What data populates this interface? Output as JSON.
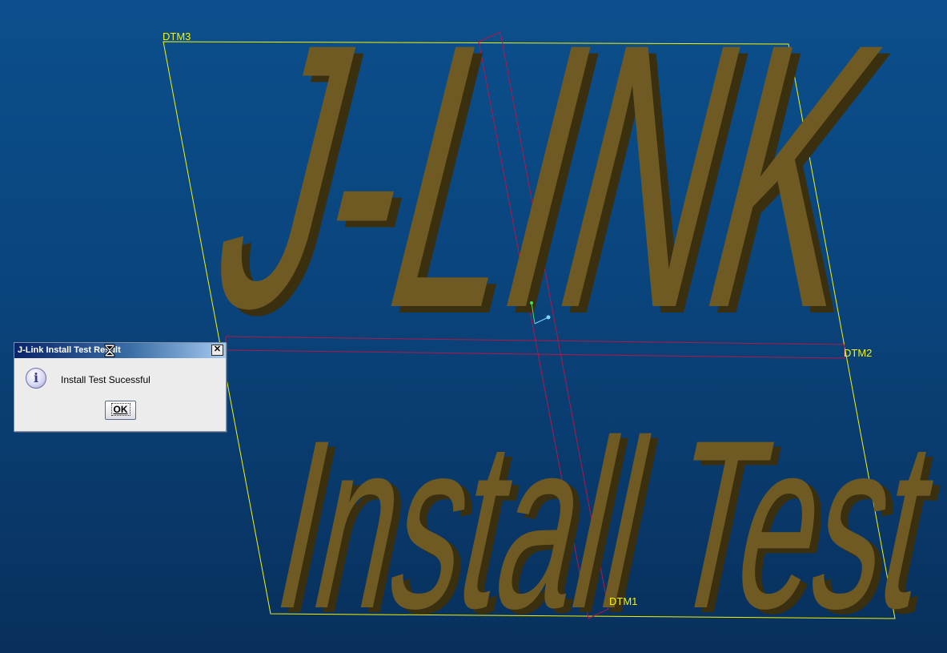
{
  "viewport": {
    "datums": {
      "top_plane": "DTM3",
      "front_plane": "DTM2",
      "right_plane": "DTM1"
    },
    "model_text": {
      "line1": "J-LINK",
      "line2": "Install Test"
    },
    "colors": {
      "background_top": "#0b4f8c",
      "background_bottom": "#08305c",
      "datum_yellow": "#f4f400",
      "datum_red": "#b0184a",
      "text_face": "#6e5a22",
      "text_side": "#3a2f0e"
    }
  },
  "dialog": {
    "title": "J-Link Install Test Result",
    "message": "Install Test Sucessful",
    "ok_label": "OK",
    "close_glyph": "✕",
    "icon": "info-icon",
    "cursor": "hourglass-cursor-icon"
  }
}
